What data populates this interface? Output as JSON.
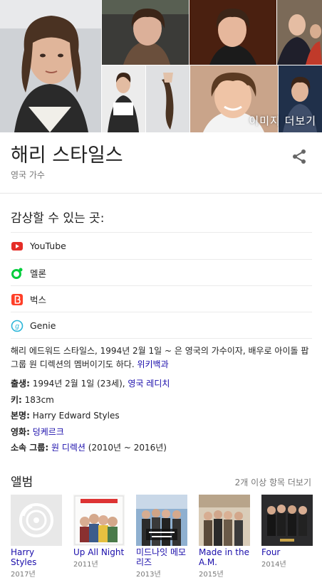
{
  "images": {
    "more_label": "이미지 더보기"
  },
  "entity": {
    "name": "해리 스타일스",
    "subtitle": "영국 가수"
  },
  "listen": {
    "heading": "감상할 수 있는 곳:",
    "services": [
      {
        "label": "YouTube",
        "icon": "youtube-icon",
        "color": "#e52d27"
      },
      {
        "label": "멜론",
        "icon": "melon-icon",
        "color": "#00cd3c"
      },
      {
        "label": "벅스",
        "icon": "bugs-icon",
        "color": "#ff3f28"
      },
      {
        "label": "Genie",
        "icon": "genie-icon",
        "color": "#2bb5d8"
      }
    ]
  },
  "description": {
    "text": "해리 에드워드 스타일스, 1994년 2월 1일 ~ 은 영국의 가수이자, 배우로 아이돌 팝 그룹 원 디렉션의 멤버이기도 하다.",
    "source": "위키백과"
  },
  "facts": {
    "born_label": "출생:",
    "born_value": "1994년 2월 1일 (23세), ",
    "born_link": "영국 레디치",
    "height_label": "키:",
    "height_value": "183cm",
    "realname_label": "본명:",
    "realname_value": "Harry Edward Styles",
    "film_label": "영화:",
    "film_link": "덩케르크",
    "group_label": "소속 그룹:",
    "group_link": "원 디렉션",
    "group_years": " (2010년 ~ 2016년)"
  },
  "albums": {
    "heading": "앨범",
    "more": "2개 이상 항목 더보기",
    "items": [
      {
        "title": "Harry Styles",
        "year": "2017년"
      },
      {
        "title": "Up All Night",
        "year": "2011년"
      },
      {
        "title": "미드나잇 메모리즈",
        "year": "2013년"
      },
      {
        "title": "Made in the A.M.",
        "year": "2015년"
      },
      {
        "title": "Four",
        "year": "2014년"
      }
    ]
  },
  "colors": {
    "link": "#1a0dab",
    "secondary_text": "#777777"
  }
}
